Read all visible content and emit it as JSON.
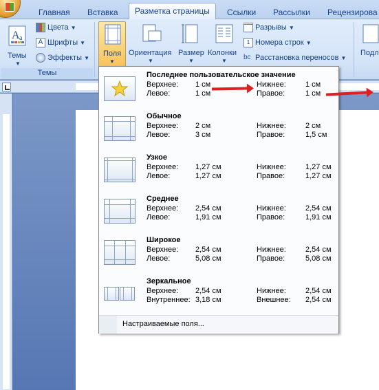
{
  "tabs": {
    "home": "Главная",
    "insert": "Вставка",
    "page_layout": "Разметка страницы",
    "references": "Ссылки",
    "mailings": "Рассылки",
    "review": "Рецензирова"
  },
  "ribbon": {
    "themes_button": "Темы",
    "colors": "Цвета",
    "fonts": "Шрифты",
    "effects": "Эффекты",
    "themes_group": "Темы",
    "margins": "Поля",
    "orientation": "Ориентация",
    "size": "Размер",
    "columns": "Колонки",
    "breaks": "Разрывы",
    "line_numbers": "Номера строк",
    "hyphenation": "Расстановка переносов",
    "right_cut": "Подл"
  },
  "margins_menu": {
    "items": [
      {
        "title": "Последнее пользовательское значение",
        "top_label": "Верхнее:",
        "top": "1 см",
        "bottom_label": "Нижнее:",
        "bottom": "1 см",
        "left_label": "Левое:",
        "left": "1 см",
        "right_label": "Правое:",
        "right": "1 см"
      },
      {
        "title": "Обычное",
        "top_label": "Верхнее:",
        "top": "2 см",
        "bottom_label": "Нижнее:",
        "bottom": "2 см",
        "left_label": "Левое:",
        "left": "3 см",
        "right_label": "Правое:",
        "right": "1,5 см"
      },
      {
        "title": "Узкое",
        "top_label": "Верхнее:",
        "top": "1,27 см",
        "bottom_label": "Нижнее:",
        "bottom": "1,27 см",
        "left_label": "Левое:",
        "left": "1,27 см",
        "right_label": "Правое:",
        "right": "1,27 см"
      },
      {
        "title": "Среднее",
        "top_label": "Верхнее:",
        "top": "2,54 см",
        "bottom_label": "Нижнее:",
        "bottom": "2,54 см",
        "left_label": "Левое:",
        "left": "1,91 см",
        "right_label": "Правое:",
        "right": "1,91 см"
      },
      {
        "title": "Широкое",
        "top_label": "Верхнее:",
        "top": "2,54 см",
        "bottom_label": "Нижнее:",
        "bottom": "2,54 см",
        "left_label": "Левое:",
        "left": "5,08 см",
        "right_label": "Правое:",
        "right": "5,08 см"
      },
      {
        "title": "Зеркальное",
        "top_label": "Верхнее:",
        "top": "2,54 см",
        "bottom_label": "Нижнее:",
        "bottom": "2,54 см",
        "left_label": "Внутреннее:",
        "left": "3,18 см",
        "right_label": "Внешнее:",
        "right": "2,54 см"
      }
    ],
    "custom": "Настраиваемые поля..."
  },
  "colors": {
    "accent": "#15428b",
    "annotation_arrow": "#e02020",
    "ribbon_bg": "#d4e4f8"
  }
}
